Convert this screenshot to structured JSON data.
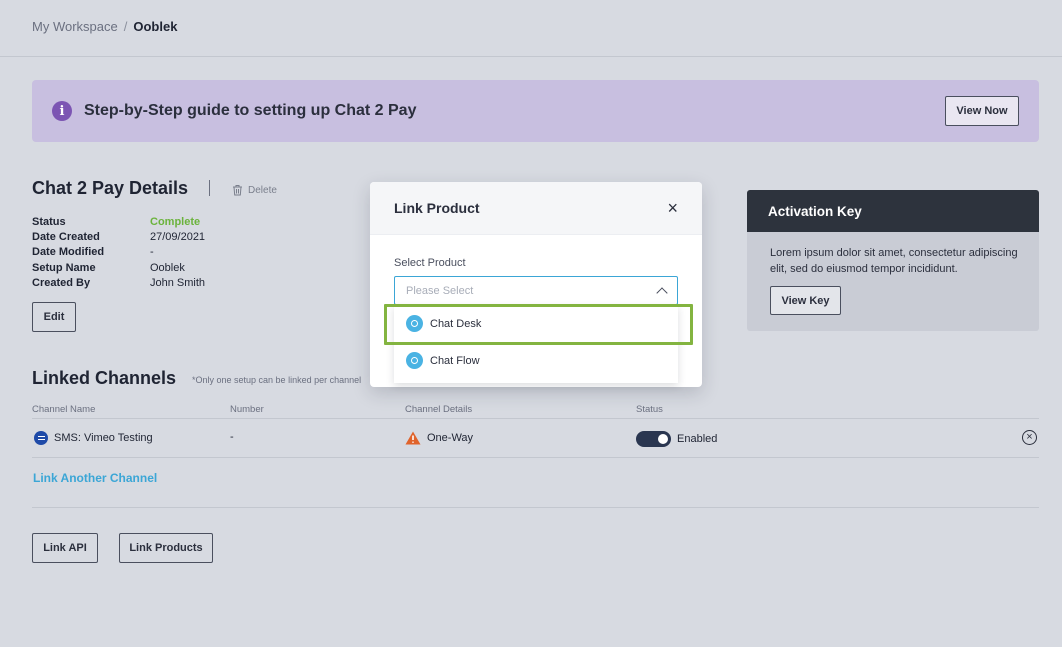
{
  "breadcrumb": {
    "root": "My Workspace",
    "separator": "/",
    "current": "Ooblek"
  },
  "banner": {
    "text": "Step-by-Step guide to setting up Chat 2 Pay",
    "button": "View Now"
  },
  "details": {
    "title": "Chat 2 Pay Details",
    "delete": "Delete",
    "fields": [
      {
        "label": "Status",
        "value": "Complete"
      },
      {
        "label": "Date Created",
        "value": "27/09/2021"
      },
      {
        "label": "Date Modified",
        "value": "-"
      },
      {
        "label": "Setup Name",
        "value": "Ooblek"
      },
      {
        "label": "Created By",
        "value": "John Smith"
      }
    ],
    "edit": "Edit"
  },
  "channels": {
    "title": "Linked Channels",
    "note": "*Only one setup can be linked per channel",
    "columns": [
      "Channel Name",
      "Number",
      "Channel Details",
      "Status"
    ],
    "rows": [
      {
        "name": "SMS: Vimeo Testing",
        "number": "-",
        "details": "One-Way",
        "status": "Enabled"
      }
    ],
    "link_another": "Link Another Channel"
  },
  "actions": {
    "link_api": "Link API",
    "link_products": "Link Products"
  },
  "activation": {
    "title": "Activation Key",
    "text": "Lorem ipsum dolor sit amet, consectetur adipiscing elit, sed do eiusmod tempor incididunt.",
    "button": "View Key"
  },
  "modal": {
    "title": "Link Product",
    "close": "×",
    "field_label": "Select Product",
    "placeholder": "Please Select",
    "options": [
      "Chat Desk",
      "Chat Flow"
    ]
  },
  "colors": {
    "accent": "#3ba6d6",
    "banner": "#c8bfe0",
    "complete": "#6bb33c",
    "highlight": "#83b440",
    "toggle": "#2a3650"
  }
}
